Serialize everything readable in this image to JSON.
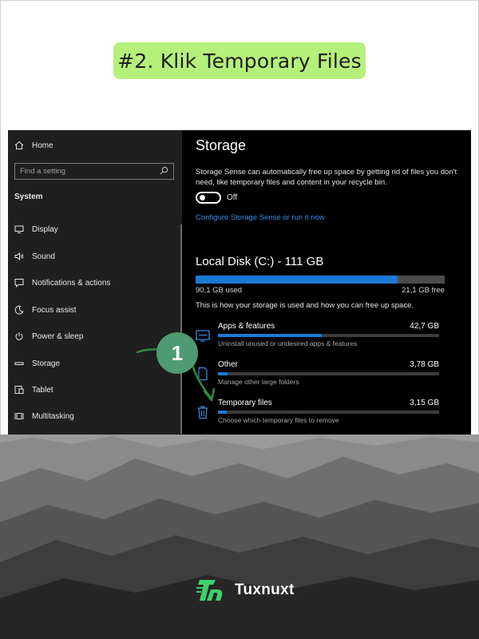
{
  "header": {
    "title": "#2. Klik Temporary Files"
  },
  "sidebar": {
    "home_label": "Home",
    "search_placeholder": "Find a setting",
    "section_label": "System",
    "items": [
      {
        "label": "Display",
        "icon": "monitor-icon"
      },
      {
        "label": "Sound",
        "icon": "speaker-icon"
      },
      {
        "label": "Notifications & actions",
        "icon": "message-icon"
      },
      {
        "label": "Focus assist",
        "icon": "moon-icon"
      },
      {
        "label": "Power & sleep",
        "icon": "power-icon"
      },
      {
        "label": "Storage",
        "icon": "drive-icon"
      },
      {
        "label": "Tablet",
        "icon": "tablet-icon"
      },
      {
        "label": "Multitasking",
        "icon": "multitask-icon"
      }
    ]
  },
  "storage": {
    "title": "Storage",
    "sense_description": "Storage Sense can automatically free up space by getting rid of files you don't need, like temporary files and content in your recycle bin.",
    "toggle_state": "Off",
    "configure_link": "Configure Storage Sense or run it now",
    "disk": {
      "title": "Local Disk (C:) - 111 GB",
      "used_label": "90,1 GB used",
      "free_label": "21,1 GB free",
      "used_fraction": 0.81
    },
    "usage_description": "This is how your storage is used and how you can free up space.",
    "categories": [
      {
        "name": "Apps & features",
        "size": "42,7 GB",
        "description": "Uninstall unused or undesired apps & features",
        "fraction": 0.47,
        "icon": "apps-icon"
      },
      {
        "name": "Other",
        "size": "3,78 GB",
        "description": "Manage other large folders",
        "fraction": 0.045,
        "icon": "document-icon"
      },
      {
        "name": "Temporary files",
        "size": "3,15 GB",
        "description": "Choose which temporary files to remove",
        "fraction": 0.038,
        "icon": "trash-icon"
      }
    ]
  },
  "annotation": {
    "step_number": "1"
  },
  "brand": {
    "name": "Tuxnuxt",
    "accent": "#3ecf6a"
  },
  "colors": {
    "title_pill": "#b5f07a",
    "progress": "#1a7ad6",
    "link": "#3a8ee6",
    "badge": "#4e9a72"
  }
}
